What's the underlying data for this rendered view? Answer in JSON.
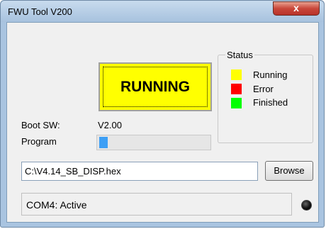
{
  "window": {
    "title": "FWU Tool V200",
    "close_glyph": "x"
  },
  "running_indicator": {
    "label": "RUNNING",
    "color": "#ffff00"
  },
  "status": {
    "group_label": "Status",
    "legend": [
      {
        "label": "Running",
        "color": "#ffff00"
      },
      {
        "label": "Error",
        "color": "#ff0000"
      },
      {
        "label": "Finished",
        "color": "#00ff00"
      }
    ]
  },
  "boot_sw": {
    "label": "Boot SW:",
    "value": "V2.00"
  },
  "program": {
    "label": "Program",
    "progress_fraction": 0.08,
    "fill_color": "#3d9ff5"
  },
  "file": {
    "path": "C:\\V4.14_SB_DISP.hex",
    "browse_label": "Browse"
  },
  "status_bar": {
    "text": "COM4: Active",
    "led_icon": "connection-led-icon"
  }
}
